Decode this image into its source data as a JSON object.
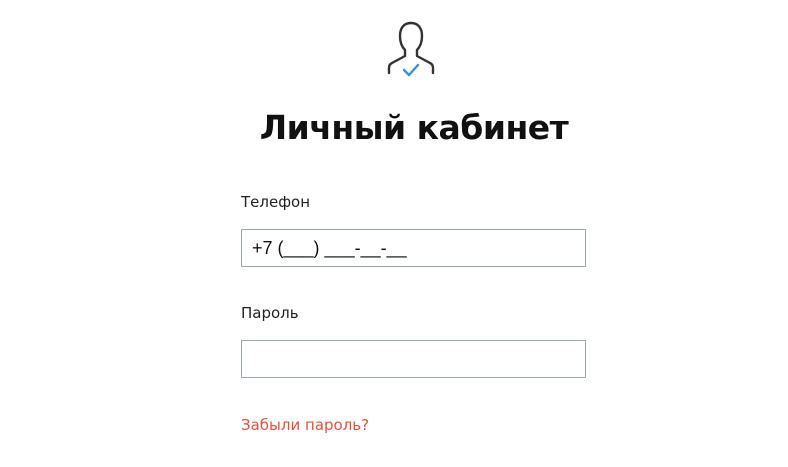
{
  "header": {
    "icon": "user-check-icon",
    "title": "Личный кабинет"
  },
  "form": {
    "phone": {
      "label": "Телефон",
      "value": "+7 (___) ___-__-__"
    },
    "password": {
      "label": "Пароль",
      "value": ""
    },
    "forgot_password_link": "Забыли пароль?"
  },
  "colors": {
    "link": "#e0533b",
    "check_accent": "#3a8fd6",
    "input_border": "#9aa9b0",
    "icon_stroke": "#333333"
  }
}
